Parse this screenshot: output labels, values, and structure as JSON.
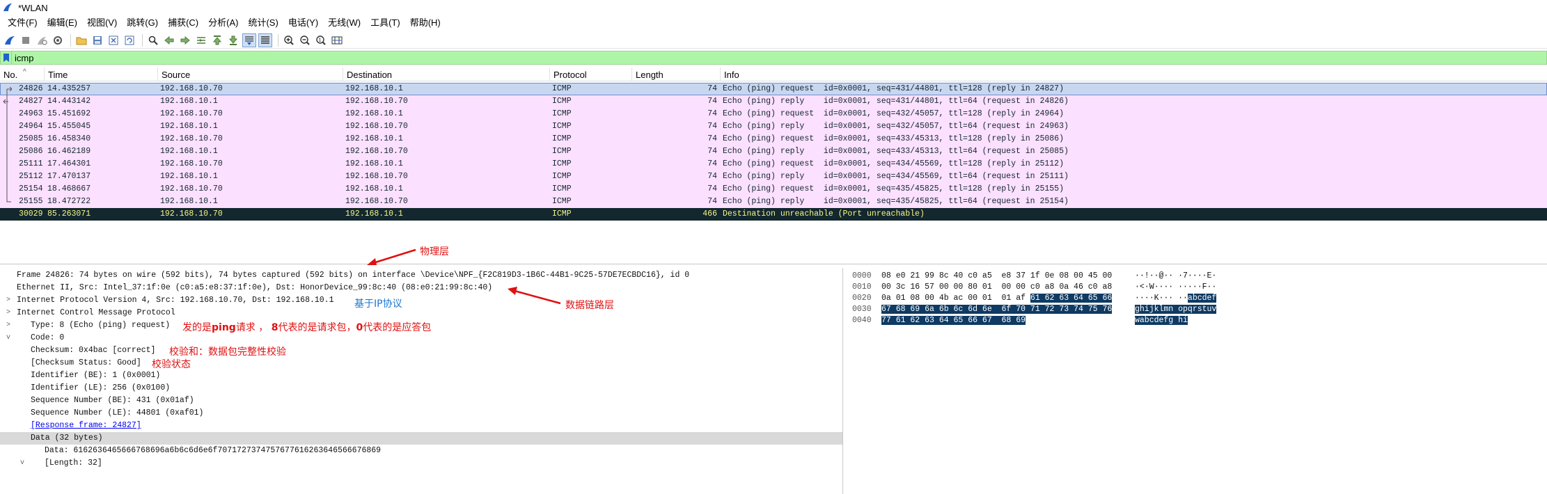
{
  "window": {
    "title": "*WLAN"
  },
  "menu": [
    "文件(F)",
    "编辑(E)",
    "视图(V)",
    "跳转(G)",
    "捕获(C)",
    "分析(A)",
    "统计(S)",
    "电话(Y)",
    "无线(W)",
    "工具(T)",
    "帮助(H)"
  ],
  "toolbar": {
    "icons": [
      "shark-fin-start-icon",
      "stop-square-icon",
      "restart-icon",
      "options-gear-icon",
      "open-folder-icon",
      "save-file-icon",
      "close-file-icon",
      "reload-icon",
      "find-icon",
      "go-back-icon",
      "go-forward-icon",
      "go-to-packet-icon",
      "first-packet-icon",
      "last-packet-icon",
      "auto-scroll-icon",
      "colorize-icon",
      "zoom-in-icon",
      "zoom-out-icon",
      "normal-size-icon",
      "resize-columns-icon"
    ]
  },
  "filter": {
    "value": "icmp"
  },
  "packet_list": {
    "columns": [
      "No.",
      "Time",
      "Source",
      "Destination",
      "Protocol",
      "Length",
      "Info"
    ],
    "rows": [
      {
        "no": "24826",
        "time": "14.435257",
        "src": "192.168.10.70",
        "dst": "192.168.10.1",
        "proto": "ICMP",
        "len": "74",
        "info": "Echo (ping) request  id=0x0001, seq=431/44801, ttl=128 (reply in 24827)",
        "state": "selected"
      },
      {
        "no": "24827",
        "time": "14.443142",
        "src": "192.168.10.1",
        "dst": "192.168.10.70",
        "proto": "ICMP",
        "len": "74",
        "info": "Echo (ping) reply    id=0x0001, seq=431/44801, ttl=64 (request in 24826)",
        "state": "normal"
      },
      {
        "no": "24963",
        "time": "15.451692",
        "src": "192.168.10.70",
        "dst": "192.168.10.1",
        "proto": "ICMP",
        "len": "74",
        "info": "Echo (ping) request  id=0x0001, seq=432/45057, ttl=128 (reply in 24964)",
        "state": "normal"
      },
      {
        "no": "24964",
        "time": "15.455045",
        "src": "192.168.10.1",
        "dst": "192.168.10.70",
        "proto": "ICMP",
        "len": "74",
        "info": "Echo (ping) reply    id=0x0001, seq=432/45057, ttl=64 (request in 24963)",
        "state": "normal"
      },
      {
        "no": "25085",
        "time": "16.458340",
        "src": "192.168.10.70",
        "dst": "192.168.10.1",
        "proto": "ICMP",
        "len": "74",
        "info": "Echo (ping) request  id=0x0001, seq=433/45313, ttl=128 (reply in 25086)",
        "state": "normal"
      },
      {
        "no": "25086",
        "time": "16.462189",
        "src": "192.168.10.1",
        "dst": "192.168.10.70",
        "proto": "ICMP",
        "len": "74",
        "info": "Echo (ping) reply    id=0x0001, seq=433/45313, ttl=64 (request in 25085)",
        "state": "normal"
      },
      {
        "no": "25111",
        "time": "17.464301",
        "src": "192.168.10.70",
        "dst": "192.168.10.1",
        "proto": "ICMP",
        "len": "74",
        "info": "Echo (ping) request  id=0x0001, seq=434/45569, ttl=128 (reply in 25112)",
        "state": "normal"
      },
      {
        "no": "25112",
        "time": "17.470137",
        "src": "192.168.10.1",
        "dst": "192.168.10.70",
        "proto": "ICMP",
        "len": "74",
        "info": "Echo (ping) reply    id=0x0001, seq=434/45569, ttl=64 (request in 25111)",
        "state": "normal"
      },
      {
        "no": "25154",
        "time": "18.468667",
        "src": "192.168.10.70",
        "dst": "192.168.10.1",
        "proto": "ICMP",
        "len": "74",
        "info": "Echo (ping) request  id=0x0001, seq=435/45825, ttl=128 (reply in 25155)",
        "state": "normal"
      },
      {
        "no": "25155",
        "time": "18.472722",
        "src": "192.168.10.1",
        "dst": "192.168.10.70",
        "proto": "ICMP",
        "len": "74",
        "info": "Echo (ping) reply    id=0x0001, seq=435/45825, ttl=64 (request in 25154)",
        "state": "normal"
      },
      {
        "no": "30029",
        "time": "85.263071",
        "src": "192.168.10.70",
        "dst": "192.168.10.1",
        "proto": "ICMP",
        "len": "466",
        "info": "Destination unreachable (Port unreachable)",
        "state": "error"
      }
    ]
  },
  "details": {
    "frame": "Frame 24826: 74 bytes on wire (592 bits), 74 bytes captured (592 bits) on interface \\Device\\NPF_{F2C819D3-1B6C-44B1-9C25-57DE7ECBDC16}, id 0",
    "ethernet": "Ethernet II, Src: Intel_37:1f:0e (c0:a5:e8:37:1f:0e), Dst: HonorDevice_99:8c:40 (08:e0:21:99:8c:40)",
    "ip": "Internet Protocol Version 4, Src: 192.168.10.70, Dst: 192.168.10.1",
    "icmp": "Internet Control Message Protocol",
    "type": "Type: 8 (Echo (ping) request)",
    "code": "Code: 0",
    "checksum": "Checksum: 0x4bac [correct]",
    "checksum_status": "[Checksum Status: Good]",
    "id_be": "Identifier (BE): 1 (0x0001)",
    "id_le": "Identifier (LE): 256 (0x0100)",
    "seq_be": "Sequence Number (BE): 431 (0x01af)",
    "seq_le": "Sequence Number (LE): 44801 (0xaf01)",
    "response": "[Response frame: 24827]",
    "data": "Data (32 bytes)",
    "data_value": "Data: 6162636465666768696a6b6c6d6e6f7071727374757677616263646566676869",
    "length": "[Length: 32]"
  },
  "bytes": {
    "rows": [
      {
        "off": "0000",
        "hex_plain": "08 e0 21 99 8c 40 c0 a5  e8 37 1f 0e 08 00 45 00",
        "hex_sel": "",
        "ascii_plain": "··!··@·· ·7····E·",
        "ascii_sel": ""
      },
      {
        "off": "0010",
        "hex_plain": "00 3c 16 57 00 00 80 01  00 00 c0 a8 0a 46 c0 a8",
        "hex_sel": "",
        "ascii_plain": "·<·W···· ·····F··",
        "ascii_sel": ""
      },
      {
        "off": "0020",
        "hex_plain": "0a 01 08 00 4b ac 00 01  01 af ",
        "hex_sel": "61 62 63 64 65 66",
        "ascii_plain": "····K··· ··",
        "ascii_sel": "abcdef"
      },
      {
        "off": "0030",
        "hex_plain": "",
        "hex_sel": "67 68 69 6a 6b 6c 6d 6e  6f 70 71 72 73 74 75 76",
        "ascii_plain": "",
        "ascii_sel": "ghijklmn opqrstuv"
      },
      {
        "off": "0040",
        "hex_plain": "",
        "hex_sel": "77 61 62 63 64 65 66 67  68 69",
        "ascii_plain": "",
        "ascii_sel": "wabcdefg hi"
      }
    ]
  },
  "annotations": {
    "physical": "物理层",
    "datalink": "数据链路层",
    "ip_proto": "基于IP协议",
    "type_note_1": "发的是",
    "type_note_ping": "ping",
    "type_note_2": "请求 ，",
    "type_note_8": "8",
    "type_note_3": "代表的是请求包，",
    "type_note_0": "0",
    "type_note_4": "代表的是应答包",
    "checksum_note": "校验和：数据包完整性校验",
    "status_note": "校验状态"
  },
  "colors": {
    "filter_bg": "#aff5a7",
    "icmp_row": "#fce0ff",
    "selected_row": "#c8d6f0",
    "error_row_bg": "#12272e",
    "error_row_fg": "#f7f787",
    "annotation_red": "#e01010",
    "annotation_blue": "#1a76d2",
    "byte_highlight": "#0e3a63"
  }
}
